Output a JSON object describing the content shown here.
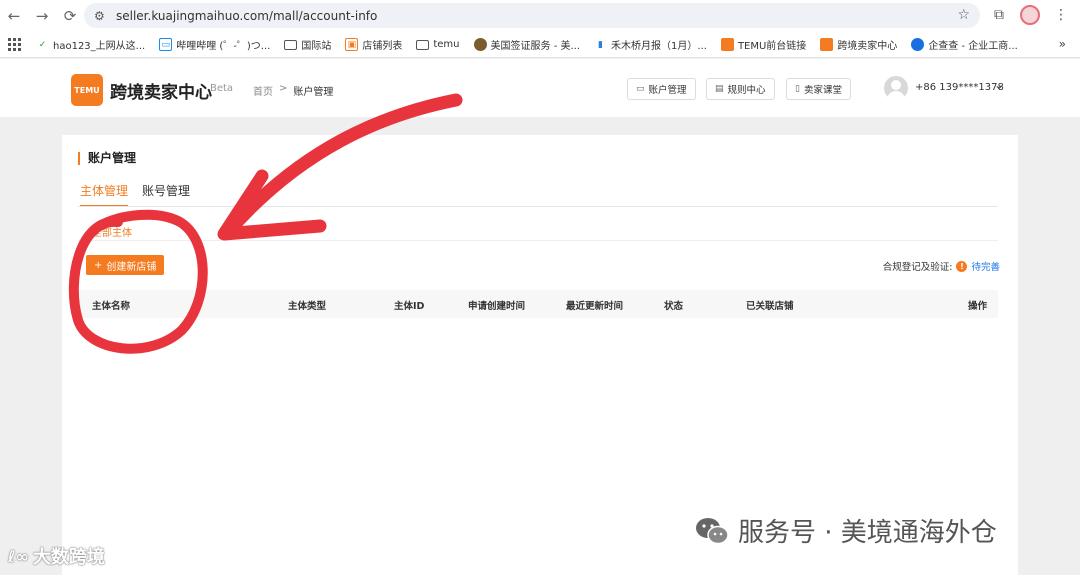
{
  "browser": {
    "url": "seller.kuajingmaihuo.com/mall/account-info",
    "nav": {
      "back": "←",
      "forward": "→",
      "reload": "⟳"
    },
    "bookmarks": [
      {
        "label": "hao123_上网从这...",
        "icon": "hao123-icon"
      },
      {
        "label": "哔哩哔哩 (゜-゜)つ...",
        "icon": "bilibili-icon"
      },
      {
        "label": "国际站",
        "icon": "folder-icon"
      },
      {
        "label": "店铺列表",
        "icon": "shop-icon"
      },
      {
        "label": "temu",
        "icon": "folder-icon"
      },
      {
        "label": "美国签证服务 - 美...",
        "icon": "seal-icon"
      },
      {
        "label": "禾木桥月报（1月）...",
        "icon": "chart-icon"
      },
      {
        "label": "TEMU前台链接",
        "icon": "temu-icon"
      },
      {
        "label": "跨境卖家中心",
        "icon": "temu-icon"
      },
      {
        "label": "企查查 - 企业工商...",
        "icon": "qcc-icon"
      }
    ],
    "more": "»"
  },
  "header": {
    "logo_text": "TEMU",
    "brand": "跨境卖家中心",
    "beta": "Beta",
    "breadcrumb": {
      "home": "首页",
      "sep": ">",
      "current": "账户管理"
    },
    "buttons": {
      "account": "账户管理",
      "rules": "规则中心",
      "classroom": "卖家课堂"
    },
    "phone": "+86 139****1378"
  },
  "main": {
    "title": "账户管理",
    "tabs": [
      "主体管理",
      "账号管理"
    ],
    "subtab": "全部主体",
    "create_button": "创建新店铺",
    "compliance_label": "合规登记及验证:",
    "compliance_status": "待完善",
    "columns": [
      "主体名称",
      "主体类型",
      "主体ID",
      "申请创建时间",
      "最近更新时间",
      "状态",
      "已关联店铺",
      "操作"
    ]
  },
  "watermarks": {
    "footer": "大数跨境",
    "service": "服务号 · 美境通海外仓"
  },
  "colors": {
    "accent": "#f47b20",
    "annotation": "#e8353d",
    "link": "#1a73e8"
  }
}
